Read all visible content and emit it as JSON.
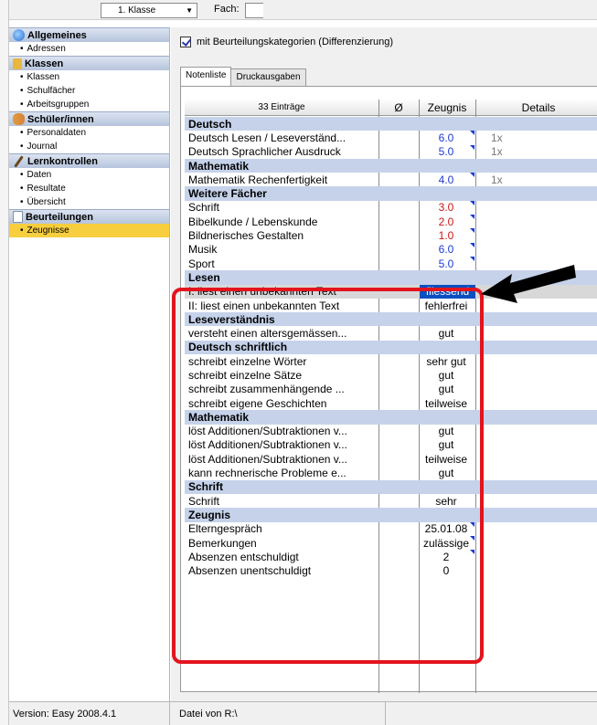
{
  "toolbar": {
    "class_combo": "1. Klasse",
    "fach_label": "Fach:"
  },
  "sidebar": {
    "groups": [
      {
        "title": "Allgemeines",
        "icon": "globe-icon",
        "items": [
          "Adressen"
        ]
      },
      {
        "title": "Klassen",
        "icon": "folder-icon",
        "items": [
          "Klassen",
          "Schulfächer",
          "Arbeitsgruppen"
        ]
      },
      {
        "title": "Schüler/innen",
        "icon": "users-icon",
        "items": [
          "Personaldaten",
          "Journal"
        ]
      },
      {
        "title": "Lernkontrollen",
        "icon": "pen-icon",
        "items": [
          "Daten",
          "Resultate",
          "Übersicht"
        ]
      },
      {
        "title": "Beurteilungen",
        "icon": "document-icon",
        "items": [
          "Zeugnisse"
        ]
      }
    ]
  },
  "main": {
    "checkbox_label": "mit Beurteilungskategorien (Differenzierung)",
    "checkbox_checked": true,
    "tabs": [
      "Notenliste",
      "Druckausgaben"
    ],
    "table": {
      "headers": [
        "33 Einträge",
        "Ø",
        "Zeugnis",
        "Details"
      ],
      "rows": [
        {
          "name": "Deutsch",
          "group": true
        },
        {
          "name": "Deutsch Lesen / Leseverständ...",
          "z": "6.0",
          "d": "1x",
          "c": "blue",
          "tri": true
        },
        {
          "name": "Deutsch Sprachlicher Ausdruck",
          "z": "5.0",
          "d": "1x",
          "c": "blue",
          "tri": true
        },
        {
          "name": "Mathematik",
          "group": true
        },
        {
          "name": "Mathematik Rechenfertigkeit",
          "z": "4.0",
          "d": "1x",
          "c": "blue",
          "tri": true
        },
        {
          "name": "Weitere Fächer",
          "group": true
        },
        {
          "name": "Schrift",
          "z": "3.0",
          "c": "red",
          "tri": true
        },
        {
          "name": "Bibelkunde / Lebenskunde",
          "z": "2.0",
          "c": "red",
          "tri": true
        },
        {
          "name": "Bildnerisches Gestalten",
          "z": "1.0",
          "c": "red",
          "tri": true
        },
        {
          "name": "Musik",
          "z": "6.0",
          "c": "blue",
          "tri": true
        },
        {
          "name": "Sport",
          "z": "5.0",
          "c": "blue",
          "tri": true
        },
        {
          "name": "Lesen",
          "group": true
        },
        {
          "name": "I: liest einen unbekannten Text",
          "z": "fliessend",
          "sel": true
        },
        {
          "name": "II: liest einen unbekannten Text",
          "z": "fehlerfrei"
        },
        {
          "name": "Leseverständnis",
          "group": true
        },
        {
          "name": "versteht einen altersgemässen...",
          "z": "gut"
        },
        {
          "name": "Deutsch schriftlich",
          "group": true
        },
        {
          "name": "schreibt einzelne Wörter",
          "z": "sehr gut"
        },
        {
          "name": "schreibt einzelne Sätze",
          "z": "gut"
        },
        {
          "name": "schreibt zusammenhängende ...",
          "z": "gut"
        },
        {
          "name": "schreibt eigene Geschichten",
          "z": "teilweise"
        },
        {
          "name": "Mathematik",
          "group": true
        },
        {
          "name": "löst Additionen/Subtraktionen v...",
          "z": "gut"
        },
        {
          "name": "löst Additionen/Subtraktionen v...",
          "z": "gut"
        },
        {
          "name": "löst Additionen/Subtraktionen v...",
          "z": "teilweise"
        },
        {
          "name": "kann rechnerische Probleme e...",
          "z": "gut"
        },
        {
          "name": "Schrift",
          "group": true
        },
        {
          "name": "Schrift",
          "z": "sehr"
        },
        {
          "name": "Zeugnis",
          "group": true
        },
        {
          "name": "Elterngespräch",
          "z": "25.01.08",
          "tri": true
        },
        {
          "name": "Bemerkungen",
          "z": "zulässige",
          "tri": true
        },
        {
          "name": "Absenzen entschuldigt",
          "z": "2",
          "tri": true
        },
        {
          "name": "Absenzen unentschuldigt",
          "z": "0"
        }
      ]
    }
  },
  "status": {
    "version": "Version: Easy 2008.4.1",
    "file": "Datei von R:\\"
  }
}
